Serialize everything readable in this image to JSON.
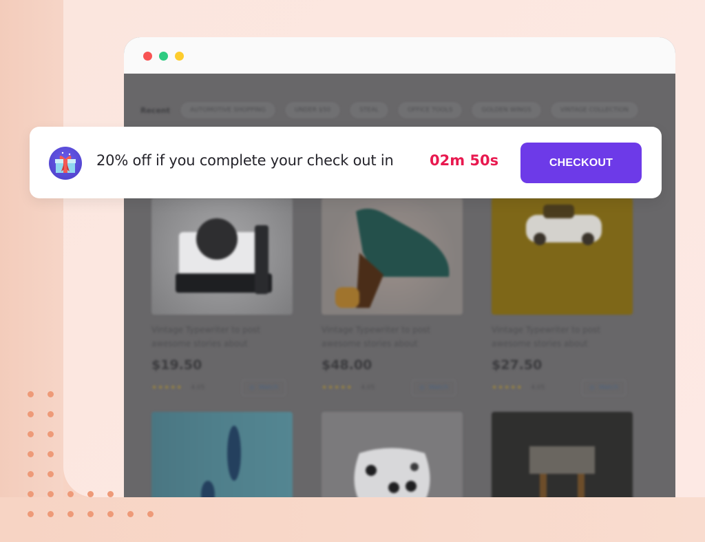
{
  "window": {
    "controls": [
      "close",
      "minimize",
      "maximize"
    ]
  },
  "store": {
    "filter_label": "Recent",
    "filters": [
      "AUTOMOTIVE SHOPPING",
      "UNDER $50",
      "STEAL",
      "OFFICE TOOLS",
      "GOLDEN WINGS",
      "VINTAGE COLLECTION"
    ],
    "products": [
      {
        "title": "Vintage Typewriter to post awesome stories about",
        "price": "$19.50",
        "stars": "★★★★★",
        "rating": "4.05",
        "action": "Watch",
        "image": "instant-camera"
      },
      {
        "title": "Vintage Typewriter to post awesome stories about",
        "price": "$48.00",
        "stars": "★★★★★",
        "rating": "4.05",
        "action": "Watch",
        "image": "green-heeled-shoe"
      },
      {
        "title": "Vintage Typewriter to post awesome stories about",
        "price": "$27.50",
        "stars": "★★★★★",
        "rating": "4.05",
        "action": "Watch",
        "image": "toy-car-on-yellow"
      },
      {
        "image": "blue-surfboard-water"
      },
      {
        "image": "white-game-controller"
      },
      {
        "image": "dark-interior"
      }
    ]
  },
  "banner": {
    "icon": "gift-icon",
    "message": "20% off if you complete your check out in",
    "timer": "02m 50s",
    "button_label": "CHECKOUT",
    "colors": {
      "timer": "#e8194f",
      "button": "#6d3ae8"
    }
  }
}
